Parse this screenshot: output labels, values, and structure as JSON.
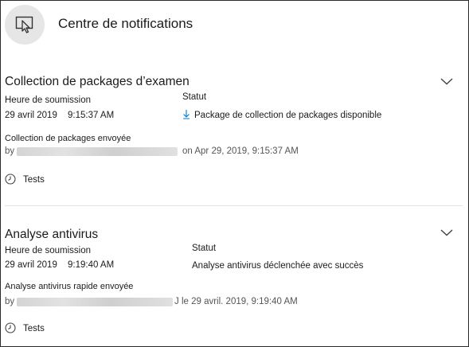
{
  "header": {
    "title": "Centre de notifications",
    "icon": "device-notification-icon"
  },
  "cards": [
    {
      "title": "Collection de packages d’examen",
      "submission_label": "Heure de soumission",
      "date": "29 avril 2019",
      "time": "9:15:37 AM",
      "status_label": "Statut",
      "status_value": "Package de collection de packages disponible",
      "status_icon": "download-icon",
      "event_text": "Collection de packages envoyée",
      "by_prefix": "by",
      "by_suffix": "on Apr 29, 2019, 9:15:37 AM",
      "tag": "Tests",
      "expanded_icon": "chevron-down-icon"
    },
    {
      "title": "Analyse antivirus",
      "submission_label": "Heure de soumission",
      "date": "29 avril 2019",
      "time": "9:19:40 AM",
      "status_label": "Statut",
      "status_value": "Analyse antivirus déclenchée avec succès",
      "event_text": "Analyse antivirus rapide envoyée",
      "by_prefix": "by",
      "by_suffix": "J le 29 avril. 2019,  9:19:40 AM",
      "tag": "Tests",
      "expanded_icon": "chevron-down-icon"
    }
  ],
  "colors": {
    "accent": "#0078d4",
    "header_icon_bg": "#e6e6e6",
    "divider": "#e3e3e3"
  }
}
